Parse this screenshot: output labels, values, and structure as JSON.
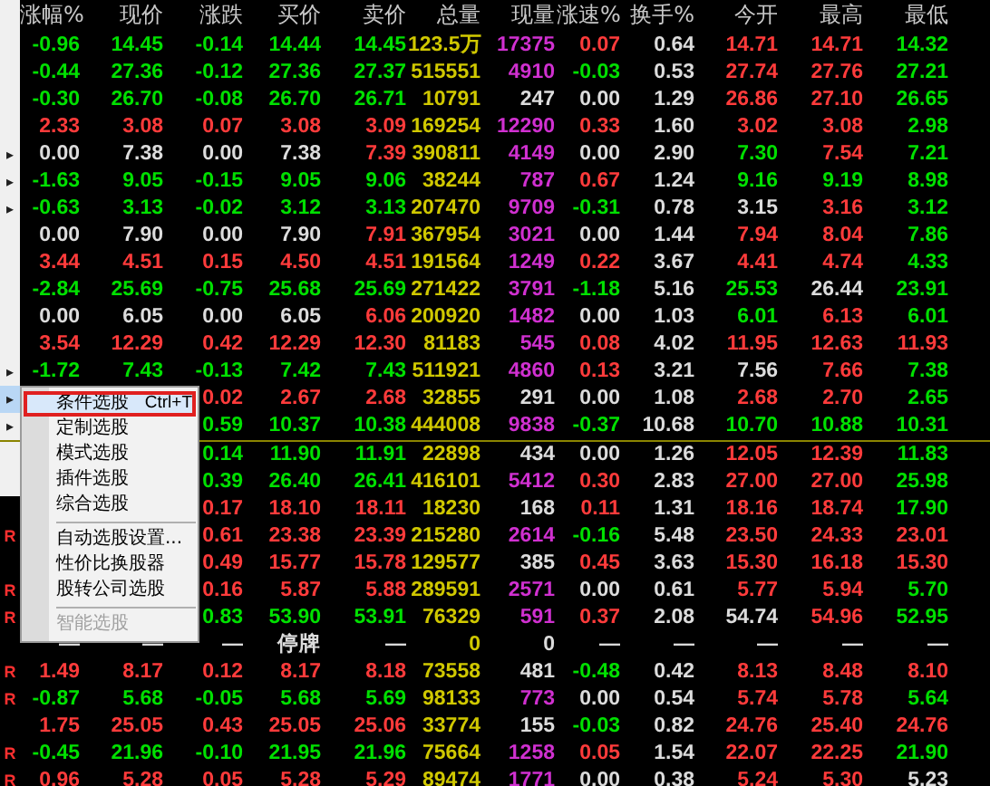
{
  "columns": [
    "涨幅%",
    "现价",
    "涨跌",
    "买价",
    "卖价",
    "总量",
    "现量",
    "涨速%",
    "换手%",
    "今开",
    "最高",
    "最低"
  ],
  "groups": [
    {
      "rows": [
        {
          "side": {
            "kind": "menu",
            "selected": false
          },
          "cells": [
            {
              "text": "-0.96",
              "color": "#00e000"
            },
            {
              "text": "14.45",
              "color": "#00e000"
            },
            {
              "text": "-0.14",
              "color": "#00e000"
            },
            {
              "text": "14.44",
              "color": "#00e000"
            },
            {
              "text": "14.45",
              "color": "#00e000"
            },
            {
              "text": "123.5万",
              "color": "#d0c800"
            },
            {
              "text": "17375",
              "color": "#d030d0"
            },
            {
              "text": "0.07",
              "color": "#ff3b3b"
            },
            {
              "text": "0.64",
              "color": "#dcdcdc"
            },
            {
              "text": "14.71",
              "color": "#ff3b3b"
            },
            {
              "text": "14.71",
              "color": "#ff3b3b"
            },
            {
              "text": "14.32",
              "color": "#00e000"
            }
          ]
        },
        {
          "side": {
            "kind": "menu",
            "selected": false
          },
          "cells": [
            {
              "text": "-0.44",
              "color": "#00e000"
            },
            {
              "text": "27.36",
              "color": "#00e000"
            },
            {
              "text": "-0.12",
              "color": "#00e000"
            },
            {
              "text": "27.36",
              "color": "#00e000"
            },
            {
              "text": "27.37",
              "color": "#00e000"
            },
            {
              "text": "515551",
              "color": "#d0c800"
            },
            {
              "text": "4910",
              "color": "#d030d0"
            },
            {
              "text": "-0.03",
              "color": "#00e000"
            },
            {
              "text": "0.53",
              "color": "#dcdcdc"
            },
            {
              "text": "27.74",
              "color": "#ff3b3b"
            },
            {
              "text": "27.76",
              "color": "#ff3b3b"
            },
            {
              "text": "27.21",
              "color": "#00e000"
            }
          ]
        },
        {
          "side": {
            "kind": "menu",
            "selected": false
          },
          "cells": [
            {
              "text": "-0.30",
              "color": "#00e000"
            },
            {
              "text": "26.70",
              "color": "#00e000"
            },
            {
              "text": "-0.08",
              "color": "#00e000"
            },
            {
              "text": "26.70",
              "color": "#00e000"
            },
            {
              "text": "26.71",
              "color": "#00e000"
            },
            {
              "text": "10791",
              "color": "#d0c800"
            },
            {
              "text": "247",
              "color": "#dcdcdc"
            },
            {
              "text": "0.00",
              "color": "#dcdcdc"
            },
            {
              "text": "1.29",
              "color": "#dcdcdc"
            },
            {
              "text": "26.86",
              "color": "#ff3b3b"
            },
            {
              "text": "27.10",
              "color": "#ff3b3b"
            },
            {
              "text": "26.65",
              "color": "#00e000"
            }
          ]
        },
        {
          "side": {
            "kind": "menu",
            "selected": false
          },
          "cells": [
            {
              "text": "2.33",
              "color": "#ff3b3b"
            },
            {
              "text": "3.08",
              "color": "#ff3b3b"
            },
            {
              "text": "0.07",
              "color": "#ff3b3b"
            },
            {
              "text": "3.08",
              "color": "#ff3b3b"
            },
            {
              "text": "3.09",
              "color": "#ff3b3b"
            },
            {
              "text": "169254",
              "color": "#d0c800"
            },
            {
              "text": "12290",
              "color": "#d030d0"
            },
            {
              "text": "0.33",
              "color": "#ff3b3b"
            },
            {
              "text": "1.60",
              "color": "#dcdcdc"
            },
            {
              "text": "3.02",
              "color": "#ff3b3b"
            },
            {
              "text": "3.08",
              "color": "#ff3b3b"
            },
            {
              "text": "2.98",
              "color": "#00e000"
            }
          ]
        },
        {
          "side": {
            "kind": "menu",
            "arrow": "▸",
            "selected": false
          },
          "cells": [
            {
              "text": "0.00",
              "color": "#dcdcdc"
            },
            {
              "text": "7.38",
              "color": "#dcdcdc"
            },
            {
              "text": "0.00",
              "color": "#dcdcdc"
            },
            {
              "text": "7.38",
              "color": "#dcdcdc"
            },
            {
              "text": "7.39",
              "color": "#ff3b3b"
            },
            {
              "text": "390811",
              "color": "#d0c800"
            },
            {
              "text": "4149",
              "color": "#d030d0"
            },
            {
              "text": "0.00",
              "color": "#dcdcdc"
            },
            {
              "text": "2.90",
              "color": "#dcdcdc"
            },
            {
              "text": "7.30",
              "color": "#00e000"
            },
            {
              "text": "7.54",
              "color": "#ff3b3b"
            },
            {
              "text": "7.21",
              "color": "#00e000"
            }
          ]
        },
        {
          "side": {
            "kind": "menu",
            "arrow": "▸",
            "selected": false
          },
          "cells": [
            {
              "text": "-1.63",
              "color": "#00e000"
            },
            {
              "text": "9.05",
              "color": "#00e000"
            },
            {
              "text": "-0.15",
              "color": "#00e000"
            },
            {
              "text": "9.05",
              "color": "#00e000"
            },
            {
              "text": "9.06",
              "color": "#00e000"
            },
            {
              "text": "38244",
              "color": "#d0c800"
            },
            {
              "text": "787",
              "color": "#d030d0"
            },
            {
              "text": "0.67",
              "color": "#ff3b3b"
            },
            {
              "text": "1.24",
              "color": "#dcdcdc"
            },
            {
              "text": "9.16",
              "color": "#00e000"
            },
            {
              "text": "9.19",
              "color": "#00e000"
            },
            {
              "text": "8.98",
              "color": "#00e000"
            }
          ]
        },
        {
          "side": {
            "kind": "menu",
            "arrow": "▸",
            "selected": false
          },
          "cells": [
            {
              "text": "-0.63",
              "color": "#00e000"
            },
            {
              "text": "3.13",
              "color": "#00e000"
            },
            {
              "text": "-0.02",
              "color": "#00e000"
            },
            {
              "text": "3.12",
              "color": "#00e000"
            },
            {
              "text": "3.13",
              "color": "#00e000"
            },
            {
              "text": "207470",
              "color": "#d0c800"
            },
            {
              "text": "9709",
              "color": "#d030d0"
            },
            {
              "text": "-0.31",
              "color": "#00e000"
            },
            {
              "text": "0.78",
              "color": "#dcdcdc"
            },
            {
              "text": "3.15",
              "color": "#dcdcdc"
            },
            {
              "text": "3.16",
              "color": "#ff3b3b"
            },
            {
              "text": "3.12",
              "color": "#00e000"
            }
          ]
        },
        {
          "side": {
            "kind": "menu",
            "selected": false
          },
          "cells": [
            {
              "text": "0.00",
              "color": "#dcdcdc"
            },
            {
              "text": "7.90",
              "color": "#dcdcdc"
            },
            {
              "text": "0.00",
              "color": "#dcdcdc"
            },
            {
              "text": "7.90",
              "color": "#dcdcdc"
            },
            {
              "text": "7.91",
              "color": "#ff3b3b"
            },
            {
              "text": "367954",
              "color": "#d0c800"
            },
            {
              "text": "3021",
              "color": "#d030d0"
            },
            {
              "text": "0.00",
              "color": "#dcdcdc"
            },
            {
              "text": "1.44",
              "color": "#dcdcdc"
            },
            {
              "text": "7.94",
              "color": "#ff3b3b"
            },
            {
              "text": "8.04",
              "color": "#ff3b3b"
            },
            {
              "text": "7.86",
              "color": "#00e000"
            }
          ]
        },
        {
          "side": {
            "kind": "menu",
            "selected": false
          },
          "cells": [
            {
              "text": "3.44",
              "color": "#ff3b3b"
            },
            {
              "text": "4.51",
              "color": "#ff3b3b"
            },
            {
              "text": "0.15",
              "color": "#ff3b3b"
            },
            {
              "text": "4.50",
              "color": "#ff3b3b"
            },
            {
              "text": "4.51",
              "color": "#ff3b3b"
            },
            {
              "text": "191564",
              "color": "#d0c800"
            },
            {
              "text": "1249",
              "color": "#d030d0"
            },
            {
              "text": "0.22",
              "color": "#ff3b3b"
            },
            {
              "text": "3.67",
              "color": "#dcdcdc"
            },
            {
              "text": "4.41",
              "color": "#ff3b3b"
            },
            {
              "text": "4.74",
              "color": "#ff3b3b"
            },
            {
              "text": "4.33",
              "color": "#00e000"
            }
          ]
        },
        {
          "side": {
            "kind": "menu",
            "selected": false
          },
          "cells": [
            {
              "text": "-2.84",
              "color": "#00e000"
            },
            {
              "text": "25.69",
              "color": "#00e000"
            },
            {
              "text": "-0.75",
              "color": "#00e000"
            },
            {
              "text": "25.68",
              "color": "#00e000"
            },
            {
              "text": "25.69",
              "color": "#00e000"
            },
            {
              "text": "271422",
              "color": "#d0c800"
            },
            {
              "text": "3791",
              "color": "#d030d0"
            },
            {
              "text": "-1.18",
              "color": "#00e000"
            },
            {
              "text": "5.16",
              "color": "#dcdcdc"
            },
            {
              "text": "25.53",
              "color": "#00e000"
            },
            {
              "text": "26.44",
              "color": "#dcdcdc"
            },
            {
              "text": "23.91",
              "color": "#00e000"
            }
          ]
        },
        {
          "side": {
            "kind": "menu",
            "selected": false
          },
          "cells": [
            {
              "text": "0.00",
              "color": "#dcdcdc"
            },
            {
              "text": "6.05",
              "color": "#dcdcdc"
            },
            {
              "text": "0.00",
              "color": "#dcdcdc"
            },
            {
              "text": "6.05",
              "color": "#dcdcdc"
            },
            {
              "text": "6.06",
              "color": "#ff3b3b"
            },
            {
              "text": "200920",
              "color": "#d0c800"
            },
            {
              "text": "1482",
              "color": "#d030d0"
            },
            {
              "text": "0.00",
              "color": "#dcdcdc"
            },
            {
              "text": "1.03",
              "color": "#dcdcdc"
            },
            {
              "text": "6.01",
              "color": "#00e000"
            },
            {
              "text": "6.13",
              "color": "#ff3b3b"
            },
            {
              "text": "6.01",
              "color": "#00e000"
            }
          ]
        },
        {
          "side": {
            "kind": "menu",
            "selected": false
          },
          "cells": [
            {
              "text": "3.54",
              "color": "#ff3b3b"
            },
            {
              "text": "12.29",
              "color": "#ff3b3b"
            },
            {
              "text": "0.42",
              "color": "#ff3b3b"
            },
            {
              "text": "12.29",
              "color": "#ff3b3b"
            },
            {
              "text": "12.30",
              "color": "#ff3b3b"
            },
            {
              "text": "81183",
              "color": "#d0c800"
            },
            {
              "text": "545",
              "color": "#d030d0"
            },
            {
              "text": "0.08",
              "color": "#ff3b3b"
            },
            {
              "text": "4.02",
              "color": "#dcdcdc"
            },
            {
              "text": "11.95",
              "color": "#ff3b3b"
            },
            {
              "text": "12.63",
              "color": "#ff3b3b"
            },
            {
              "text": "11.93",
              "color": "#ff3b3b"
            }
          ]
        },
        {
          "side": {
            "kind": "menu",
            "arrow": "▸",
            "selected": false
          },
          "cells": [
            {
              "text": "-1.72",
              "color": "#00e000"
            },
            {
              "text": "7.43",
              "color": "#00e000"
            },
            {
              "text": "-0.13",
              "color": "#00e000"
            },
            {
              "text": "7.42",
              "color": "#00e000"
            },
            {
              "text": "7.43",
              "color": "#00e000"
            },
            {
              "text": "511921",
              "color": "#d0c800"
            },
            {
              "text": "4860",
              "color": "#d030d0"
            },
            {
              "text": "0.13",
              "color": "#ff3b3b"
            },
            {
              "text": "3.21",
              "color": "#dcdcdc"
            },
            {
              "text": "7.56",
              "color": "#dcdcdc"
            },
            {
              "text": "7.66",
              "color": "#ff3b3b"
            },
            {
              "text": "7.38",
              "color": "#00e000"
            }
          ]
        },
        {
          "side": {
            "kind": "menu",
            "arrow": "▸",
            "selected": true
          },
          "cells": [
            null,
            null,
            {
              "text": "0.02",
              "color": "#ff3b3b"
            },
            {
              "text": "2.67",
              "color": "#ff3b3b"
            },
            {
              "text": "2.68",
              "color": "#ff3b3b"
            },
            {
              "text": "32855",
              "color": "#d0c800"
            },
            {
              "text": "291",
              "color": "#dcdcdc"
            },
            {
              "text": "0.00",
              "color": "#dcdcdc"
            },
            {
              "text": "1.08",
              "color": "#dcdcdc"
            },
            {
              "text": "2.68",
              "color": "#ff3b3b"
            },
            {
              "text": "2.70",
              "color": "#ff3b3b"
            },
            {
              "text": "2.65",
              "color": "#00e000"
            }
          ]
        },
        {
          "side": {
            "kind": "menu",
            "arrow": "▸",
            "selected": false
          },
          "cells": [
            null,
            null,
            {
              "text": "0.59",
              "color": "#00e000"
            },
            {
              "text": "10.37",
              "color": "#00e000"
            },
            {
              "text": "10.38",
              "color": "#00e000"
            },
            {
              "text": "444008",
              "color": "#d0c800"
            },
            {
              "text": "9838",
              "color": "#d030d0"
            },
            {
              "text": "-0.37",
              "color": "#00e000"
            },
            {
              "text": "10.68",
              "color": "#dcdcdc"
            },
            {
              "text": "10.70",
              "color": "#00e000"
            },
            {
              "text": "10.88",
              "color": "#00e000"
            },
            {
              "text": "10.31",
              "color": "#00e000"
            }
          ]
        }
      ]
    },
    {
      "rows": [
        {
          "side": {
            "kind": "menu",
            "selected": false
          },
          "cells": [
            null,
            null,
            {
              "text": "0.14",
              "color": "#00e000"
            },
            {
              "text": "11.90",
              "color": "#00e000"
            },
            {
              "text": "11.91",
              "color": "#00e000"
            },
            {
              "text": "22898",
              "color": "#d0c800"
            },
            {
              "text": "434",
              "color": "#dcdcdc"
            },
            {
              "text": "0.00",
              "color": "#dcdcdc"
            },
            {
              "text": "1.26",
              "color": "#dcdcdc"
            },
            {
              "text": "12.05",
              "color": "#ff3b3b"
            },
            {
              "text": "12.39",
              "color": "#ff3b3b"
            },
            {
              "text": "11.83",
              "color": "#00e000"
            }
          ]
        },
        {
          "side": {
            "kind": "menu",
            "selected": false
          },
          "cells": [
            null,
            null,
            {
              "text": "0.39",
              "color": "#00e000"
            },
            {
              "text": "26.40",
              "color": "#00e000"
            },
            {
              "text": "26.41",
              "color": "#00e000"
            },
            {
              "text": "416101",
              "color": "#d0c800"
            },
            {
              "text": "5412",
              "color": "#d030d0"
            },
            {
              "text": "0.30",
              "color": "#ff3b3b"
            },
            {
              "text": "2.83",
              "color": "#dcdcdc"
            },
            {
              "text": "27.00",
              "color": "#ff3b3b"
            },
            {
              "text": "27.00",
              "color": "#ff3b3b"
            },
            {
              "text": "25.98",
              "color": "#00e000"
            }
          ]
        },
        {
          "cells": [
            null,
            null,
            {
              "text": "0.17",
              "color": "#ff3b3b"
            },
            {
              "text": "18.10",
              "color": "#ff3b3b"
            },
            {
              "text": "18.11",
              "color": "#ff3b3b"
            },
            {
              "text": "18230",
              "color": "#d0c800"
            },
            {
              "text": "168",
              "color": "#dcdcdc"
            },
            {
              "text": "0.11",
              "color": "#ff3b3b"
            },
            {
              "text": "1.31",
              "color": "#dcdcdc"
            },
            {
              "text": "18.16",
              "color": "#ff3b3b"
            },
            {
              "text": "18.74",
              "color": "#ff3b3b"
            },
            {
              "text": "17.90",
              "color": "#00e000"
            }
          ]
        },
        {
          "side": {
            "kind": "marker",
            "text": "R"
          },
          "cells": [
            null,
            null,
            {
              "text": "0.61",
              "color": "#ff3b3b"
            },
            {
              "text": "23.38",
              "color": "#ff3b3b"
            },
            {
              "text": "23.39",
              "color": "#ff3b3b"
            },
            {
              "text": "215280",
              "color": "#d0c800"
            },
            {
              "text": "2614",
              "color": "#d030d0"
            },
            {
              "text": "-0.16",
              "color": "#00e000"
            },
            {
              "text": "5.48",
              "color": "#dcdcdc"
            },
            {
              "text": "23.50",
              "color": "#ff3b3b"
            },
            {
              "text": "24.33",
              "color": "#ff3b3b"
            },
            {
              "text": "23.01",
              "color": "#ff3b3b"
            }
          ]
        },
        {
          "cells": [
            null,
            null,
            {
              "text": "0.49",
              "color": "#ff3b3b"
            },
            {
              "text": "15.77",
              "color": "#ff3b3b"
            },
            {
              "text": "15.78",
              "color": "#ff3b3b"
            },
            {
              "text": "129577",
              "color": "#d0c800"
            },
            {
              "text": "385",
              "color": "#dcdcdc"
            },
            {
              "text": "0.45",
              "color": "#ff3b3b"
            },
            {
              "text": "3.63",
              "color": "#dcdcdc"
            },
            {
              "text": "15.30",
              "color": "#ff3b3b"
            },
            {
              "text": "16.18",
              "color": "#ff3b3b"
            },
            {
              "text": "15.30",
              "color": "#ff3b3b"
            }
          ]
        },
        {
          "side": {
            "kind": "marker",
            "text": "R"
          },
          "cells": [
            null,
            null,
            {
              "text": "0.16",
              "color": "#ff3b3b"
            },
            {
              "text": "5.87",
              "color": "#ff3b3b"
            },
            {
              "text": "5.88",
              "color": "#ff3b3b"
            },
            {
              "text": "289591",
              "color": "#d0c800"
            },
            {
              "text": "2571",
              "color": "#d030d0"
            },
            {
              "text": "0.00",
              "color": "#dcdcdc"
            },
            {
              "text": "0.61",
              "color": "#dcdcdc"
            },
            {
              "text": "5.77",
              "color": "#ff3b3b"
            },
            {
              "text": "5.94",
              "color": "#ff3b3b"
            },
            {
              "text": "5.70",
              "color": "#00e000"
            }
          ]
        },
        {
          "side": {
            "kind": "marker",
            "text": "R"
          },
          "cells": [
            null,
            null,
            {
              "text": "0.83",
              "color": "#00e000"
            },
            {
              "text": "53.90",
              "color": "#00e000"
            },
            {
              "text": "53.91",
              "color": "#00e000"
            },
            {
              "text": "76329",
              "color": "#d0c800"
            },
            {
              "text": "591",
              "color": "#d030d0"
            },
            {
              "text": "0.37",
              "color": "#ff3b3b"
            },
            {
              "text": "2.08",
              "color": "#dcdcdc"
            },
            {
              "text": "54.74",
              "color": "#dcdcdc"
            },
            {
              "text": "54.96",
              "color": "#ff3b3b"
            },
            {
              "text": "52.95",
              "color": "#00e000"
            }
          ]
        },
        {
          "cells": [
            {
              "text": "—",
              "color": "#dcdcdc"
            },
            {
              "text": "—",
              "color": "#dcdcdc"
            },
            {
              "text": "—",
              "color": "#dcdcdc"
            },
            {
              "text": "停牌",
              "color": "#dcdcdc"
            },
            {
              "text": "—",
              "color": "#dcdcdc"
            },
            {
              "text": "0",
              "color": "#d0c800"
            },
            {
              "text": "0",
              "color": "#dcdcdc"
            },
            {
              "text": "—",
              "color": "#dcdcdc"
            },
            {
              "text": "—",
              "color": "#dcdcdc"
            },
            {
              "text": "—",
              "color": "#dcdcdc"
            },
            {
              "text": "—",
              "color": "#dcdcdc"
            },
            {
              "text": "—",
              "color": "#dcdcdc"
            }
          ]
        },
        {
          "side": {
            "kind": "marker",
            "text": "R"
          },
          "cells": [
            {
              "text": "1.49",
              "color": "#ff3b3b"
            },
            {
              "text": "8.17",
              "color": "#ff3b3b"
            },
            {
              "text": "0.12",
              "color": "#ff3b3b"
            },
            {
              "text": "8.17",
              "color": "#ff3b3b"
            },
            {
              "text": "8.18",
              "color": "#ff3b3b"
            },
            {
              "text": "73558",
              "color": "#d0c800"
            },
            {
              "text": "481",
              "color": "#dcdcdc"
            },
            {
              "text": "-0.48",
              "color": "#00e000"
            },
            {
              "text": "0.42",
              "color": "#dcdcdc"
            },
            {
              "text": "8.13",
              "color": "#ff3b3b"
            },
            {
              "text": "8.48",
              "color": "#ff3b3b"
            },
            {
              "text": "8.10",
              "color": "#ff3b3b"
            }
          ]
        },
        {
          "side": {
            "kind": "marker",
            "text": "R"
          },
          "cells": [
            {
              "text": "-0.87",
              "color": "#00e000"
            },
            {
              "text": "5.68",
              "color": "#00e000"
            },
            {
              "text": "-0.05",
              "color": "#00e000"
            },
            {
              "text": "5.68",
              "color": "#00e000"
            },
            {
              "text": "5.69",
              "color": "#00e000"
            },
            {
              "text": "98133",
              "color": "#d0c800"
            },
            {
              "text": "773",
              "color": "#d030d0"
            },
            {
              "text": "0.00",
              "color": "#dcdcdc"
            },
            {
              "text": "0.54",
              "color": "#dcdcdc"
            },
            {
              "text": "5.74",
              "color": "#ff3b3b"
            },
            {
              "text": "5.78",
              "color": "#ff3b3b"
            },
            {
              "text": "5.64",
              "color": "#00e000"
            }
          ]
        },
        {
          "cells": [
            {
              "text": "1.75",
              "color": "#ff3b3b"
            },
            {
              "text": "25.05",
              "color": "#ff3b3b"
            },
            {
              "text": "0.43",
              "color": "#ff3b3b"
            },
            {
              "text": "25.05",
              "color": "#ff3b3b"
            },
            {
              "text": "25.06",
              "color": "#ff3b3b"
            },
            {
              "text": "33774",
              "color": "#d0c800"
            },
            {
              "text": "155",
              "color": "#dcdcdc"
            },
            {
              "text": "-0.03",
              "color": "#00e000"
            },
            {
              "text": "0.82",
              "color": "#dcdcdc"
            },
            {
              "text": "24.76",
              "color": "#ff3b3b"
            },
            {
              "text": "25.40",
              "color": "#ff3b3b"
            },
            {
              "text": "24.76",
              "color": "#ff3b3b"
            }
          ]
        },
        {
          "side": {
            "kind": "marker",
            "text": "R"
          },
          "cells": [
            {
              "text": "-0.45",
              "color": "#00e000"
            },
            {
              "text": "21.96",
              "color": "#00e000"
            },
            {
              "text": "-0.10",
              "color": "#00e000"
            },
            {
              "text": "21.95",
              "color": "#00e000"
            },
            {
              "text": "21.96",
              "color": "#00e000"
            },
            {
              "text": "75664",
              "color": "#d0c800"
            },
            {
              "text": "1258",
              "color": "#d030d0"
            },
            {
              "text": "0.05",
              "color": "#ff3b3b"
            },
            {
              "text": "1.54",
              "color": "#dcdcdc"
            },
            {
              "text": "22.07",
              "color": "#ff3b3b"
            },
            {
              "text": "22.25",
              "color": "#ff3b3b"
            },
            {
              "text": "21.90",
              "color": "#00e000"
            }
          ]
        },
        {
          "side": {
            "kind": "marker",
            "text": "R"
          },
          "cells": [
            {
              "text": "0.96",
              "color": "#ff3b3b"
            },
            {
              "text": "5.28",
              "color": "#ff3b3b"
            },
            {
              "text": "0.05",
              "color": "#ff3b3b"
            },
            {
              "text": "5.28",
              "color": "#ff3b3b"
            },
            {
              "text": "5.29",
              "color": "#ff3b3b"
            },
            {
              "text": "89474",
              "color": "#d0c800"
            },
            {
              "text": "1771",
              "color": "#d030d0"
            },
            {
              "text": "0.00",
              "color": "#dcdcdc"
            },
            {
              "text": "0.38",
              "color": "#dcdcdc"
            },
            {
              "text": "5.24",
              "color": "#ff3b3b"
            },
            {
              "text": "5.30",
              "color": "#ff3b3b"
            },
            {
              "text": "5.23",
              "color": "#dcdcdc"
            }
          ]
        }
      ]
    }
  ],
  "context_menu": {
    "items": [
      {
        "kind": "item",
        "label": "条件选股",
        "shortcut": "Ctrl+T",
        "selected": true,
        "disabled": false
      },
      {
        "kind": "item",
        "label": "定制选股",
        "selected": false,
        "disabled": false
      },
      {
        "kind": "item",
        "label": "模式选股",
        "selected": false,
        "disabled": false
      },
      {
        "kind": "item",
        "label": "插件选股",
        "selected": false,
        "disabled": false
      },
      {
        "kind": "item",
        "label": "综合选股",
        "selected": false,
        "disabled": false
      },
      {
        "kind": "separator"
      },
      {
        "kind": "item",
        "label": "自动选股设置...",
        "selected": false,
        "disabled": false
      },
      {
        "kind": "item",
        "label": "性价比换股器",
        "selected": false,
        "disabled": false
      },
      {
        "kind": "item",
        "label": "股转公司选股",
        "selected": false,
        "disabled": false
      },
      {
        "kind": "separator"
      },
      {
        "kind": "item",
        "label": "智能选股",
        "selected": false,
        "disabled": true
      }
    ]
  }
}
